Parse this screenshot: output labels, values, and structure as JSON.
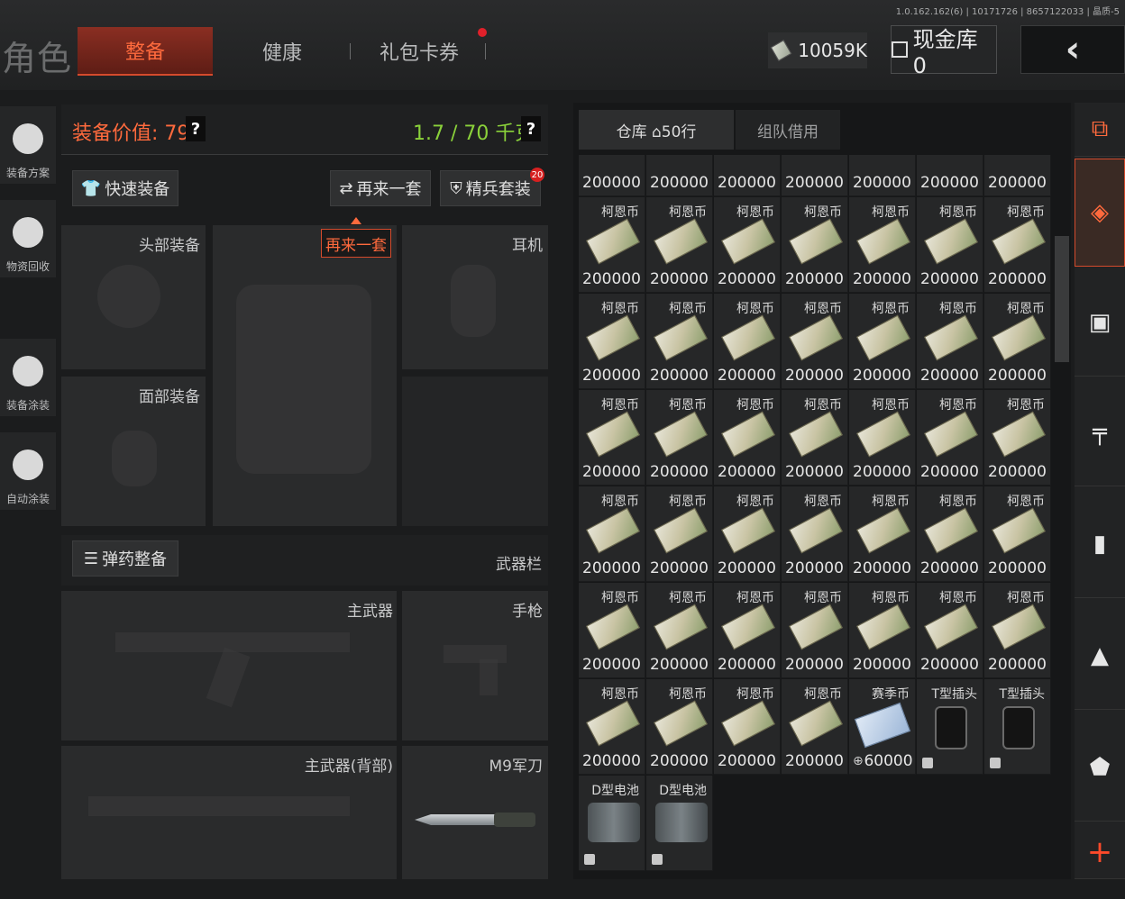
{
  "version": "1.0.162.162(6) | 10171726 | 8657122033 | 晶质-5",
  "app_title": "角色",
  "tabs": [
    "整备",
    "健康",
    "礼包卡券"
  ],
  "money": "10059K",
  "cashbox": "现金库 0",
  "back_icon": "‹",
  "left_rail": [
    "装备方案",
    "物资回收",
    "装备涂装",
    "自动涂装"
  ],
  "equip": {
    "value": "装备价值: 799",
    "weight": "1.7 / 70 千克",
    "help": "?",
    "quick_btn": "快速装备",
    "again_btn": "再来一套",
    "elite_btn": "精兵套装",
    "elite_badge": "20",
    "tooltip": "再来一套"
  },
  "slots": {
    "head": "头部装备",
    "ear": "耳机",
    "face": "面部装备",
    "ammo_btn": "弹药整备",
    "weapon_col": "武器栏",
    "primary": "主武器",
    "pistol": "手枪",
    "primary_back": "主武器(背部)",
    "knife": "M9军刀"
  },
  "warehouse": {
    "tab1": "仓库 ⌂50行",
    "tab2": "组队借用",
    "top_row_qty": "200000",
    "items": [
      {
        "name": "柯恩币",
        "qty": "200000",
        "type": "bill"
      },
      {
        "name": "柯恩币",
        "qty": "200000",
        "type": "bill"
      },
      {
        "name": "柯恩币",
        "qty": "200000",
        "type": "bill"
      },
      {
        "name": "柯恩币",
        "qty": "200000",
        "type": "bill"
      },
      {
        "name": "柯恩币",
        "qty": "200000",
        "type": "bill"
      },
      {
        "name": "柯恩币",
        "qty": "200000",
        "type": "bill"
      },
      {
        "name": "柯恩币",
        "qty": "200000",
        "type": "bill"
      },
      {
        "name": "柯恩币",
        "qty": "200000",
        "type": "bill"
      },
      {
        "name": "柯恩币",
        "qty": "200000",
        "type": "bill"
      },
      {
        "name": "柯恩币",
        "qty": "200000",
        "type": "bill"
      },
      {
        "name": "柯恩币",
        "qty": "200000",
        "type": "bill"
      },
      {
        "name": "柯恩币",
        "qty": "200000",
        "type": "bill"
      },
      {
        "name": "柯恩币",
        "qty": "200000",
        "type": "bill"
      },
      {
        "name": "柯恩币",
        "qty": "200000",
        "type": "bill"
      },
      {
        "name": "柯恩币",
        "qty": "200000",
        "type": "bill"
      },
      {
        "name": "柯恩币",
        "qty": "200000",
        "type": "bill"
      },
      {
        "name": "柯恩币",
        "qty": "200000",
        "type": "bill"
      },
      {
        "name": "柯恩币",
        "qty": "200000",
        "type": "bill"
      },
      {
        "name": "柯恩币",
        "qty": "200000",
        "type": "bill"
      },
      {
        "name": "柯恩币",
        "qty": "200000",
        "type": "bill"
      },
      {
        "name": "柯恩币",
        "qty": "200000",
        "type": "bill"
      },
      {
        "name": "柯恩币",
        "qty": "200000",
        "type": "bill"
      },
      {
        "name": "柯恩币",
        "qty": "200000",
        "type": "bill"
      },
      {
        "name": "柯恩币",
        "qty": "200000",
        "type": "bill"
      },
      {
        "name": "柯恩币",
        "qty": "200000",
        "type": "bill"
      },
      {
        "name": "柯恩币",
        "qty": "200000",
        "type": "bill"
      },
      {
        "name": "柯恩币",
        "qty": "200000",
        "type": "bill"
      },
      {
        "name": "柯恩币",
        "qty": "200000",
        "type": "bill"
      },
      {
        "name": "柯恩币",
        "qty": "200000",
        "type": "bill"
      },
      {
        "name": "柯恩币",
        "qty": "200000",
        "type": "bill"
      },
      {
        "name": "柯恩币",
        "qty": "200000",
        "type": "bill"
      },
      {
        "name": "柯恩币",
        "qty": "200000",
        "type": "bill"
      },
      {
        "name": "柯恩币",
        "qty": "200000",
        "type": "bill"
      },
      {
        "name": "柯恩币",
        "qty": "200000",
        "type": "bill"
      },
      {
        "name": "柯恩币",
        "qty": "200000",
        "type": "bill"
      },
      {
        "name": "柯恩币",
        "qty": "200000",
        "type": "bill"
      },
      {
        "name": "柯恩币",
        "qty": "200000",
        "type": "bill"
      },
      {
        "name": "柯恩币",
        "qty": "200000",
        "type": "bill"
      },
      {
        "name": "柯恩币",
        "qty": "200000",
        "type": "bill"
      },
      {
        "name": "赛季币",
        "qty": "60000",
        "type": "coin"
      },
      {
        "name": "T型插头",
        "qty": "",
        "type": "plug"
      },
      {
        "name": "T型插头",
        "qty": "",
        "type": "plug"
      },
      {
        "name": "D型电池",
        "qty": "",
        "type": "battery"
      },
      {
        "name": "D型电池",
        "qty": "",
        "type": "battery"
      }
    ]
  },
  "right_rail": [
    "stack-icon",
    "layers-icon",
    "vest-icon",
    "rifle-icon",
    "magazine-icon",
    "ammo-icon",
    "shield-icon",
    "plus-icon"
  ]
}
